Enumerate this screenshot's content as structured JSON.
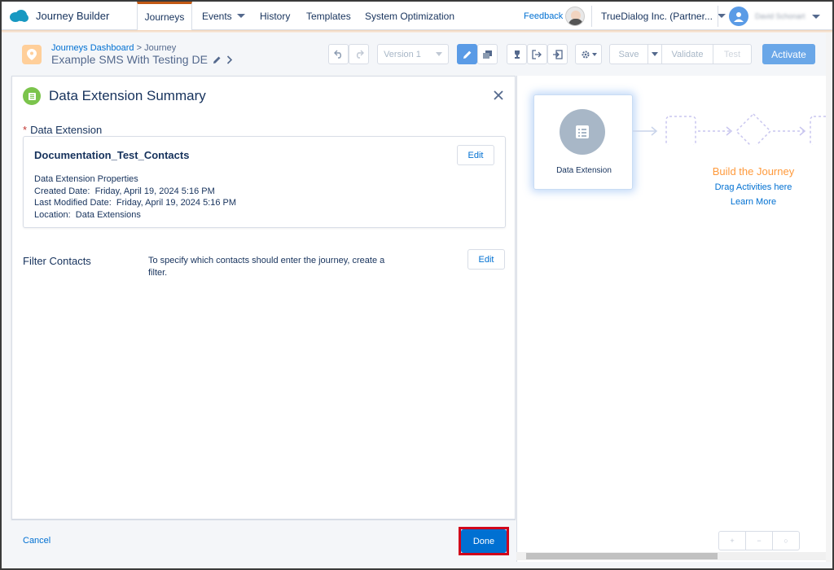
{
  "nav": {
    "app_name": "Journey Builder",
    "tabs": [
      {
        "label": "Journeys",
        "active": true
      },
      {
        "label": "Events",
        "has_caret": true
      },
      {
        "label": "History"
      },
      {
        "label": "Templates"
      },
      {
        "label": "System Optimization"
      }
    ],
    "feedback": "Feedback",
    "org_name": "TrueDialog Inc. (Partner...",
    "user_name": "David Schonart"
  },
  "toolbar": {
    "breadcrumb_link": "Journeys Dashboard",
    "breadcrumb_sep": ">",
    "breadcrumb_current": "Journey",
    "journey_name": "Example SMS With Testing DE",
    "version": "Version 1",
    "save": "Save",
    "validate": "Validate",
    "test": "Test",
    "activate": "Activate"
  },
  "panel": {
    "title": "Data Extension Summary",
    "required_marker": "*",
    "section_label": "Data Extension",
    "de_name": "Documentation_Test_Contacts",
    "edit_label": "Edit",
    "properties_heading": "Data Extension Properties",
    "created_label": "Created Date:",
    "created_value": "Friday, April 19, 2024 5:16 PM",
    "modified_label": "Last Modified Date:",
    "modified_value": "Friday, April 19, 2024 5:16 PM",
    "location_label": "Location:",
    "location_value": "Data Extensions",
    "filter_label": "Filter Contacts",
    "filter_text": "To specify which contacts should enter the journey, create a filter.",
    "filter_edit": "Edit"
  },
  "footer": {
    "cancel": "Cancel",
    "done": "Done"
  },
  "canvas": {
    "tile_label": "Data Extension",
    "build_title": "Build the Journey",
    "drag_text": "Drag Activities here",
    "learn_more": "Learn More"
  },
  "colors": {
    "accent_blue": "#0070d2",
    "highlight_red": "#d0021b",
    "build_orange": "#ff9a3c"
  },
  "icons": [
    "salesforce-cloud-icon",
    "caret-down-icon",
    "avatar-icon",
    "map-pin-icon",
    "pencil-icon",
    "chevron-right-icon",
    "undo-icon",
    "redo-icon",
    "edit-icon",
    "copy-icon",
    "trophy-icon",
    "exit-icon",
    "exit-criteria-icon",
    "gear-icon",
    "list-icon",
    "close-icon"
  ]
}
